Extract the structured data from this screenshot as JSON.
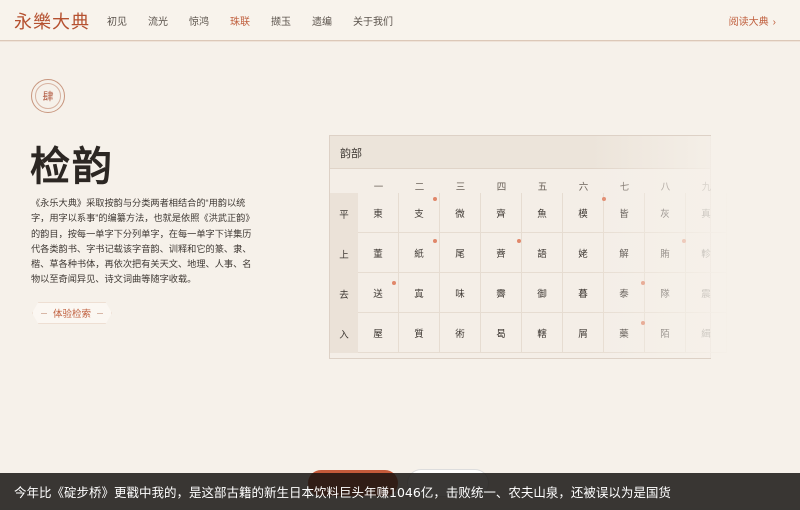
{
  "header": {
    "logo": "永樂大典",
    "nav": [
      "初见",
      "流光",
      "惊鸿",
      "珠联",
      "撷玉",
      "遗编",
      "关于我们"
    ],
    "active_index": 3,
    "read_link": "阅读大典",
    "read_chevron": "›"
  },
  "section": {
    "seal_char": "肆",
    "title": "检韵",
    "description": "《永乐大典》采取按韵与分类两者相结合的“用韵以统字，用字以系事”的编纂方法，也就是依照《洪武正韵》的韵目，按每一单字下分列单字，在每一单字下详集历代各类韵书、字书记载该字音韵、训释和它的篆、隶、楷、草各种书体，再依次把有关天文、地理、人事、名物以至奇闻异见、诗文词曲等随字收载。",
    "cta": "体验检索"
  },
  "table": {
    "title": "韵部",
    "columns": [
      "一",
      "二",
      "三",
      "四",
      "五",
      "六",
      "七",
      "八",
      "九"
    ],
    "rows": [
      {
        "tone": "平",
        "cells": [
          "東",
          "支",
          "微",
          "齊",
          "魚",
          "模",
          "皆",
          "灰",
          "真"
        ]
      },
      {
        "tone": "上",
        "cells": [
          "董",
          "紙",
          "尾",
          "薺",
          "語",
          "姥",
          "解",
          "賄",
          "軫"
        ]
      },
      {
        "tone": "去",
        "cells": [
          "送",
          "寘",
          "味",
          "霽",
          "御",
          "暮",
          "泰",
          "隊",
          "震"
        ]
      },
      {
        "tone": "入",
        "cells": [
          "屋",
          "質",
          "術",
          "曷",
          "轄",
          "屑",
          "藥",
          "陌",
          "緝"
        ]
      }
    ]
  },
  "caption": "今年比《碇步桥》更戳中我的，是这部古籍的新生日本饮料巨头年赚1046亿，击败统一、农夫山泉，还被误以为是国货",
  "colors": {
    "accent": "#c0603f",
    "background": "#f6f1ea",
    "caption_bg": "#141210"
  }
}
